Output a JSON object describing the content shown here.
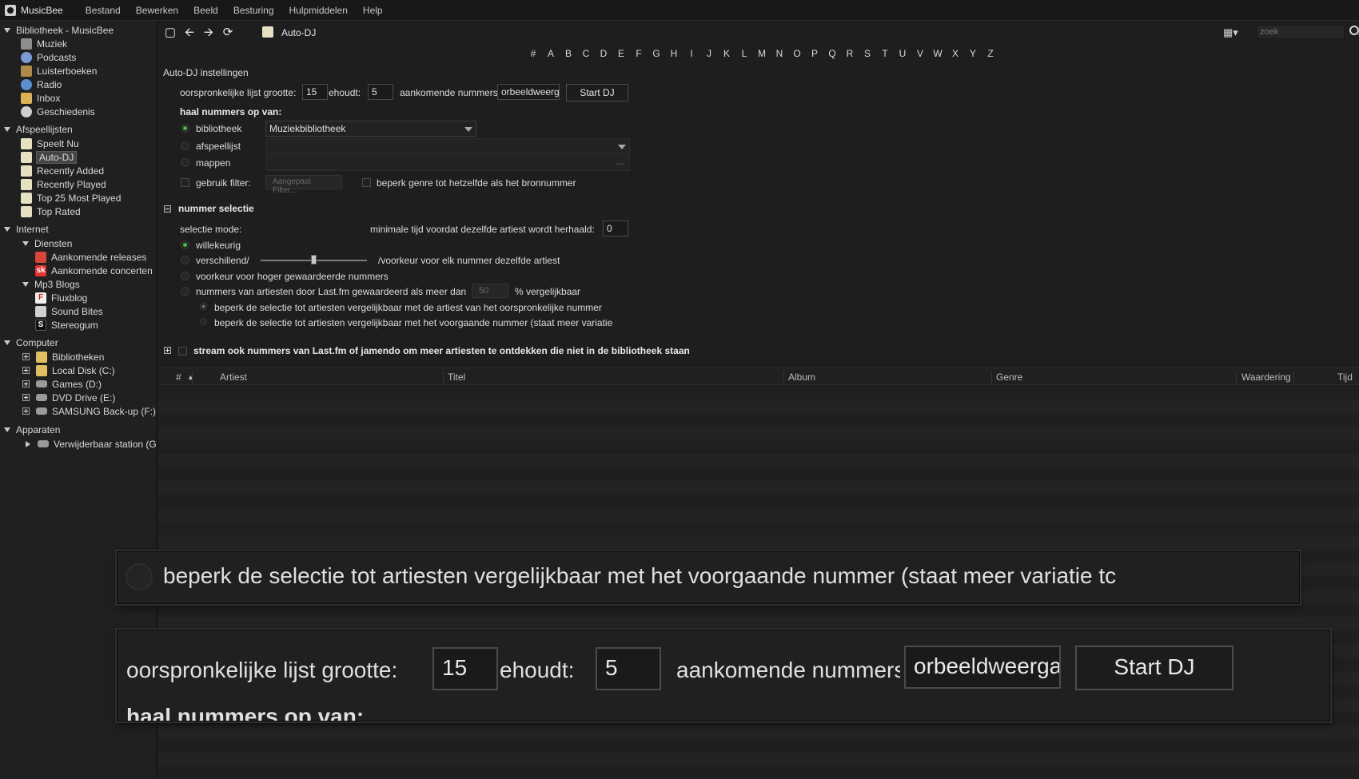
{
  "app": {
    "name": "MusicBee"
  },
  "menu": [
    "Bestand",
    "Bewerken",
    "Beeld",
    "Besturing",
    "Hulpmiddelen",
    "Help"
  ],
  "sidebar": {
    "library_header": "Bibliotheek - MusicBee",
    "library": [
      "Muziek",
      "Podcasts",
      "Luisterboeken",
      "Radio",
      "Inbox",
      "Geschiedenis"
    ],
    "playlists_header": "Afspeellijsten",
    "playlists": [
      "Speelt Nu",
      "Auto-DJ",
      "Recently Added",
      "Recently Played",
      "Top 25 Most Played",
      "Top Rated"
    ],
    "internet_header": "Internet",
    "services_header": "Diensten",
    "services": [
      "Aankomende releases",
      "Aankomende concerten"
    ],
    "mp3blogs_header": "Mp3 Blogs",
    "mp3blogs": [
      "Fluxblog",
      "Sound Bites",
      "Stereogum"
    ],
    "computer_header": "Computer",
    "computer": [
      "Bibliotheken",
      "Local Disk (C:)",
      "Games (D:)",
      "DVD Drive (E:)",
      "SAMSUNG Back-up (F:)"
    ],
    "devices_header": "Apparaten",
    "devices": [
      "Verwijderbaar station (G:"
    ]
  },
  "toolbar": {
    "title": "Auto-DJ",
    "search_placeholder": "zoek"
  },
  "alphabet": [
    "#",
    "A",
    "B",
    "C",
    "D",
    "E",
    "F",
    "G",
    "H",
    "I",
    "J",
    "K",
    "L",
    "M",
    "N",
    "O",
    "P",
    "Q",
    "R",
    "S",
    "T",
    "U",
    "V",
    "W",
    "X",
    "Y",
    "Z"
  ],
  "autodj": {
    "settings_title": "Auto-DJ instellingen",
    "list_size_label": "oorspronkelijke lijst grootte:",
    "list_size_value": "15",
    "keeps_label": "ehoudt:",
    "keeps_value": "5",
    "upcoming_label": "aankomende nummers",
    "preview_value": "orbeeldweerga",
    "start_button": "Start DJ",
    "source_header": "haal nummers op van:",
    "source_library": "bibliotheek",
    "source_library_value": "Muziekbibliotheek",
    "source_playlist": "afspeellijst",
    "source_folders": "mappen",
    "folder_browse": "...",
    "use_filter": "gebruik filter:",
    "custom_filter": "Aangepast Filter...",
    "limit_genre": "beperk genre tot hetzelfde als het bronnummer",
    "selection_header": "nummer selectie",
    "selection_mode": "selectie mode:",
    "min_time_label": "minimale tijd voordat dezelfde artiest wordt herhaald:",
    "min_time_value": "0",
    "mode_random": "willekeurig",
    "mode_different": "verschillend/",
    "mode_different_suffix": "/voorkeur voor elk nummer dezelfde artiest",
    "mode_higher_rated": "voorkeur voor hoger gewaardeerde nummers",
    "mode_lastfm": "nummers van artiesten door Last.fm gewaardeerd als meer dan",
    "lastfm_value": "50",
    "lastfm_suffix": "% vergelijkbaar",
    "limit_original": "beperk de selectie tot artiesten vergelijkbaar met de artiest van het oorspronkelijke nummer",
    "limit_previous": "beperk de selectie tot artiesten vergelijkbaar met het voorgaande nummer (staat meer variatie tc",
    "stream_label": "stream ook nummers van Last.fm of jamendo om meer artiesten te ontdekken die niet in de bibliotheek staan"
  },
  "table": {
    "columns": [
      "#",
      "Artiest",
      "Titel",
      "Album",
      "Genre",
      "Waardering",
      "Tijd"
    ]
  },
  "zoom1": {
    "text": "beperk de selectie tot artiesten vergelijkbaar met het voorgaande nummer (staat meer variatie tc"
  },
  "zoom2": {
    "list_size_label": "oorspronkelijke lijst grootte:",
    "list_size_value": "15",
    "keeps_label": "ehoudt:",
    "keeps_value": "5",
    "upcoming_label": "aankomende nummers",
    "preview_value": "orbeeldweerga",
    "start_button": "Start DJ",
    "source_header": "haal nummers op van:"
  }
}
